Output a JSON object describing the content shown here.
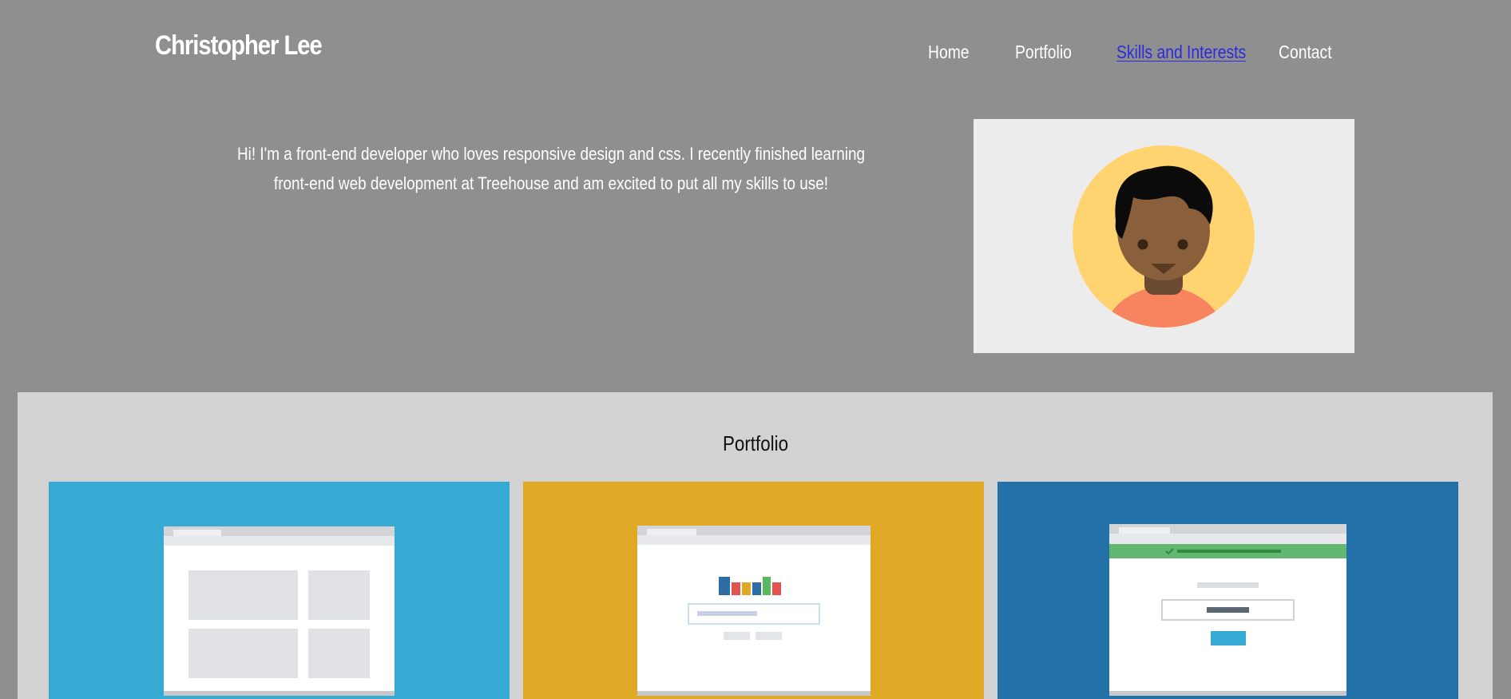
{
  "header": {
    "site_name": "Christopher Lee"
  },
  "nav": {
    "items": [
      {
        "label": "Home"
      },
      {
        "label": "Portfolio"
      },
      {
        "label": "Skills and Interests",
        "active": true
      },
      {
        "label": "Contact"
      }
    ]
  },
  "intro": {
    "text": "Hi! I'm a front-end developer who loves responsive design and css. I recently finished learning front-end web development at Treehouse and am excited to put all my skills to use!",
    "avatar_icon": "user-avatar-icon"
  },
  "portfolio": {
    "title": "Portfolio",
    "cards": [
      {
        "icon": "layout-grid-illustration",
        "color": "#36aad3"
      },
      {
        "icon": "bar-chart-form-illustration",
        "color": "#e0a925"
      },
      {
        "icon": "success-form-illustration",
        "color": "#2471aa"
      }
    ]
  },
  "colors": {
    "page_background": "#8f8f8f",
    "portfolio_background": "#d3d3d3",
    "active_link": "#2b2bdd"
  }
}
